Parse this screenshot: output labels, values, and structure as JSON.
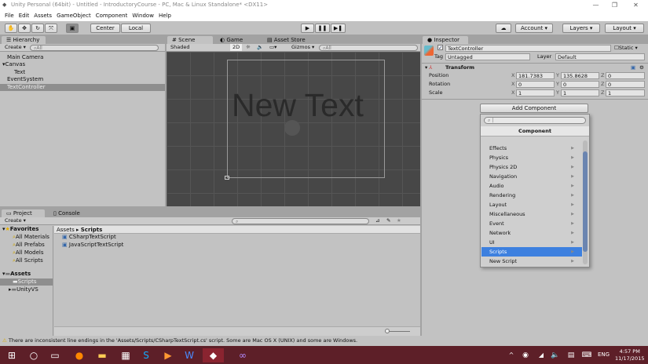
{
  "window": {
    "title": "Unity Personal (64bit) - Untitled - IntroductoryCourse - PC, Mac & Linux Standalone* <DX11>"
  },
  "menu": [
    "File",
    "Edit",
    "Assets",
    "GameObject",
    "Component",
    "Window",
    "Help"
  ],
  "toolbar": {
    "center": "Center",
    "local": "Local",
    "account": "Account",
    "layers": "Layers",
    "layout": "Layout"
  },
  "hierarchy": {
    "tab": "Hierarchy",
    "create": "Create",
    "search_placeholder": "All",
    "items": [
      "Main Camera",
      "Canvas",
      "Text",
      "EventSystem",
      "TextController"
    ]
  },
  "scene": {
    "tabs": [
      "Scene",
      "Game",
      "Asset Store"
    ],
    "shading": "Shaded",
    "mode2d": "2D",
    "gizmos": "Gizmos",
    "search_placeholder": "All",
    "canvas_text": "New Text"
  },
  "inspector": {
    "tab": "Inspector",
    "object_name": "TextController",
    "static": "Static",
    "tag_label": "Tag",
    "tag": "Untagged",
    "layer_label": "Layer",
    "layer": "Default",
    "component": "Transform",
    "rows": [
      {
        "label": "Position",
        "x": "181.7383",
        "y": "135.8628",
        "z": "0"
      },
      {
        "label": "Rotation",
        "x": "0",
        "y": "0",
        "z": "0"
      },
      {
        "label": "Scale",
        "x": "1",
        "y": "1",
        "z": "1"
      }
    ],
    "add_component": "Add Component",
    "popup_header": "Component",
    "popup_items": [
      "Effects",
      "Physics",
      "Physics 2D",
      "Navigation",
      "Audio",
      "Rendering",
      "Layout",
      "Miscellaneous",
      "Event",
      "Network",
      "UI",
      "Scripts",
      "New Script"
    ],
    "selected_item": "Scripts"
  },
  "project": {
    "tabs": [
      "Project",
      "Console"
    ],
    "create": "Create",
    "favorites": "Favorites",
    "fav_items": [
      "All Materials",
      "All Prefabs",
      "All Models",
      "All Scripts"
    ],
    "assets": "Assets",
    "asset_folders": [
      "Scripts",
      "UnityVS"
    ],
    "breadcrumb": [
      "Assets",
      "Scripts"
    ],
    "files": [
      "CSharpTextScript",
      "JavaScriptTextScript"
    ]
  },
  "status": {
    "message": "There are inconsistent line endings in the 'Assets/Scripts/CSharpTextScript.cs' script. Some are Mac OS X (UNIX) and some are Windows."
  },
  "taskbar": {
    "lang": "ENG",
    "time": "4:57 PM",
    "date": "11/17/2015"
  },
  "colors": {
    "taskbar": "#5d1f28",
    "selection": "#3d80df",
    "scene_bg": "#474747"
  }
}
